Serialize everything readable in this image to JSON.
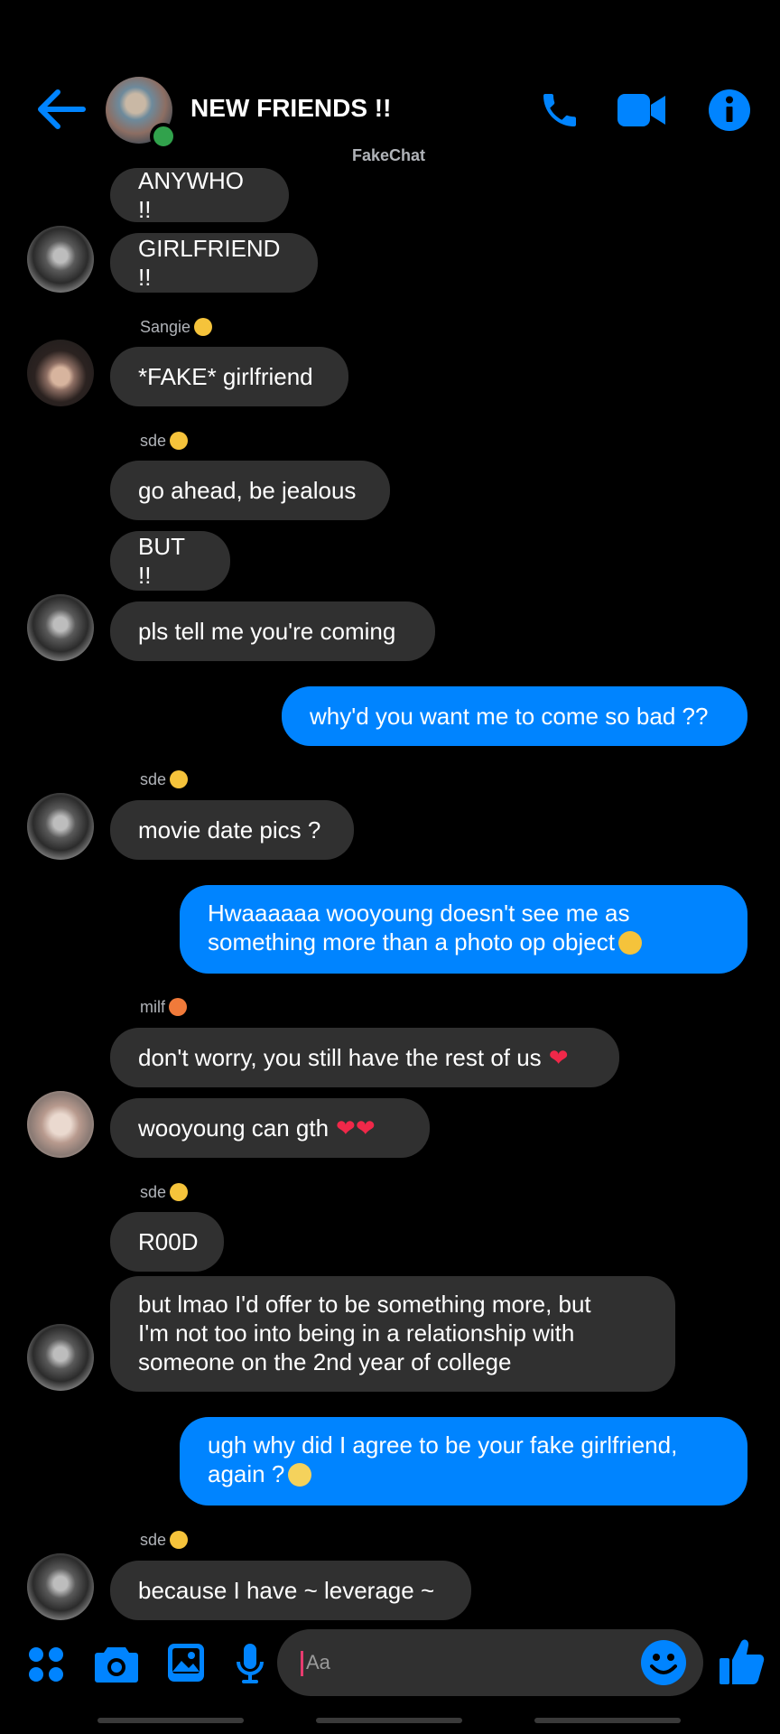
{
  "header": {
    "title": "NEW FRIENDS !!",
    "watermark": "FakeChat",
    "accent_color": "#0084ff",
    "icons": [
      "back-arrow-icon",
      "phone-icon",
      "video-camera-icon",
      "info-icon"
    ]
  },
  "messages": {
    "m1": "ANYWHO !!",
    "m2": "GIRLFRIEND !!",
    "s1": "Sangie",
    "m3": "*FAKE* girlfriend",
    "s2": "sde",
    "m4": "go ahead, be jealous",
    "m5": "BUT !!",
    "m6": "pls tell me you're coming",
    "m7": "why'd you want me to come so bad ??",
    "s3": "sde",
    "m8": "movie date pics ?",
    "m9_l1": "Hwaaaaaa wooyoung doesn't see me as",
    "m9_l2": "something more than a photo op object",
    "s4": "milf",
    "m10": "don't worry, you still have the rest of us",
    "m11": "wooyoung can gth",
    "s5": "sde",
    "m12": "R00D",
    "m13_l1": "but lmao I'd offer to be something more, but",
    "m13_l2": "I'm not too into being in a relationship with",
    "m13_l3": "someone on the 2nd year of college",
    "m14_l1": "ugh why did I agree to be your fake girlfriend,",
    "m14_l2": "again ?",
    "s6": "sde",
    "m15": "because I have ~ leverage ~"
  },
  "composer": {
    "placeholder": "Aa",
    "icons": [
      "apps-icon",
      "camera-icon",
      "gallery-icon",
      "microphone-icon",
      "emoji-icon",
      "thumbs-up-icon"
    ]
  },
  "colors": {
    "incoming_bubble": "#303030",
    "outgoing_bubble": "#0084ff",
    "background": "#000000"
  }
}
